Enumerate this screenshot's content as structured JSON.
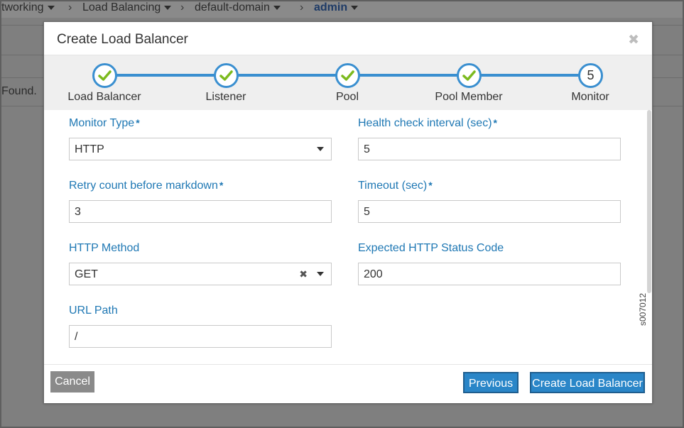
{
  "background": {
    "breadcrumb": [
      {
        "label": "tworking",
        "has_caret": true
      },
      {
        "label": "Load Balancing",
        "has_caret": true
      },
      {
        "label": "default-domain",
        "has_caret": true
      },
      {
        "label": "admin",
        "has_caret": true,
        "active": true
      }
    ],
    "not_found_text": "Found."
  },
  "modal": {
    "title": "Create Load Balancer",
    "close_icon": "close-icon"
  },
  "wizard": {
    "steps": [
      {
        "label": "Load Balancer",
        "state": "complete"
      },
      {
        "label": "Listener",
        "state": "complete"
      },
      {
        "label": "Pool",
        "state": "complete"
      },
      {
        "label": "Pool Member",
        "state": "complete"
      },
      {
        "label": "Monitor",
        "state": "current",
        "number": "5"
      }
    ],
    "check_color": "#7cba1e",
    "accent_color": "#3a8fd0"
  },
  "form": {
    "monitor_type": {
      "label": "Monitor Type",
      "required_mark": "*",
      "value": "HTTP"
    },
    "health_check_interval": {
      "label": "Health check interval (sec)",
      "required_mark": "*",
      "value": "5"
    },
    "retry_count": {
      "label": "Retry count before markdown",
      "required_mark": "*",
      "value": "3"
    },
    "timeout": {
      "label": "Timeout (sec)",
      "required_mark": "*",
      "value": "5"
    },
    "http_method": {
      "label": "HTTP Method",
      "value": "GET",
      "clear_icon": "✖"
    },
    "expected_status": {
      "label": "Expected HTTP Status Code",
      "value": "200"
    },
    "url_path": {
      "label": "URL Path",
      "value": "/"
    }
  },
  "watermark": "s007012",
  "footer": {
    "cancel_label": "Cancel",
    "previous_label": "Previous",
    "create_label": "Create Load Balancer"
  }
}
